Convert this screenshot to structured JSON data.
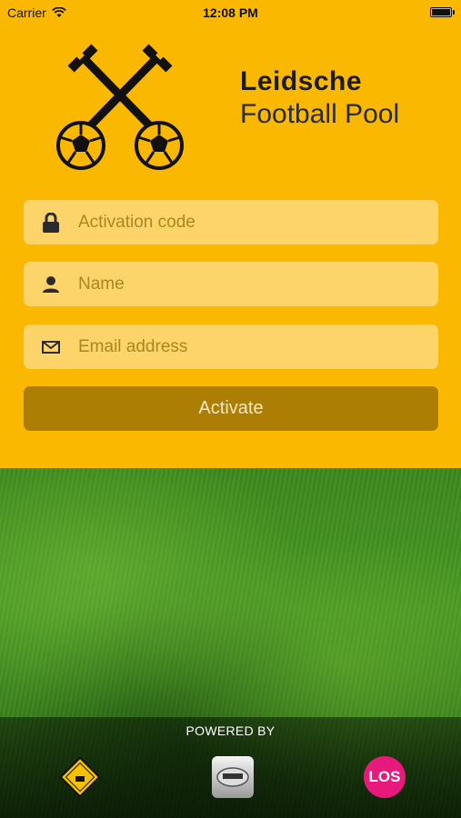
{
  "status_bar": {
    "carrier": "Carrier",
    "time": "12:08 PM",
    "icons": [
      "wifi-icon",
      "battery-icon"
    ]
  },
  "brand": {
    "title_line1": "Leidsche",
    "title_line2": "Football Pool",
    "logo": "crossed-keys-footballs-logo"
  },
  "form": {
    "activation_code": {
      "placeholder": "Activation code",
      "value": "",
      "icon": "lock-icon"
    },
    "name": {
      "placeholder": "Name",
      "value": "",
      "icon": "person-icon"
    },
    "email": {
      "placeholder": "Email address",
      "value": "",
      "icon": "envelope-icon"
    },
    "activate_label": "Activate"
  },
  "footer": {
    "powered_by": "POWERED BY",
    "sponsors": [
      {
        "name": "the-dugout-logo",
        "text": ""
      },
      {
        "name": "app-studio-logo",
        "text": ""
      },
      {
        "name": "los-logo",
        "text": "LOS"
      }
    ]
  },
  "colors": {
    "brand_yellow": "#fbb800",
    "field_bg": "#fdd46a",
    "button_bg": "#ad7e04",
    "los_pink": "#e8197c"
  }
}
